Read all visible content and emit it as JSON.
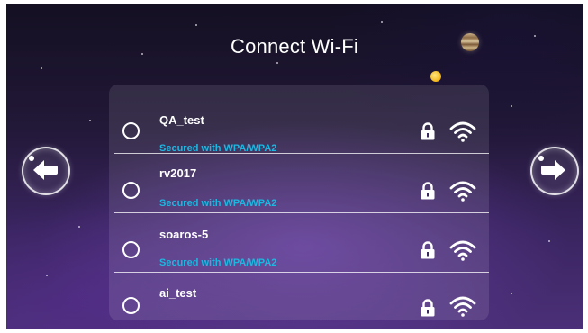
{
  "screen": {
    "title": "Connect Wi-Fi"
  },
  "networks": [
    {
      "ssid": "QA_test",
      "security": "Secured with WPA/WPA2",
      "locked": true,
      "signal": "full"
    },
    {
      "ssid": "rv2017",
      "security": "Secured with WPA/WPA2",
      "locked": true,
      "signal": "full"
    },
    {
      "ssid": "soaros-5",
      "security": "Secured with WPA/WPA2",
      "locked": true,
      "signal": "full"
    },
    {
      "ssid": "ai_test",
      "security": "",
      "locked": true,
      "signal": "full"
    }
  ],
  "navigation": {
    "back_icon": "arrow-left-icon",
    "next_icon": "arrow-right-icon"
  },
  "colors": {
    "security_text": "#1fb6e0",
    "text": "#ffffff",
    "background_top": "#141022",
    "background_bottom": "#4b2f78"
  }
}
